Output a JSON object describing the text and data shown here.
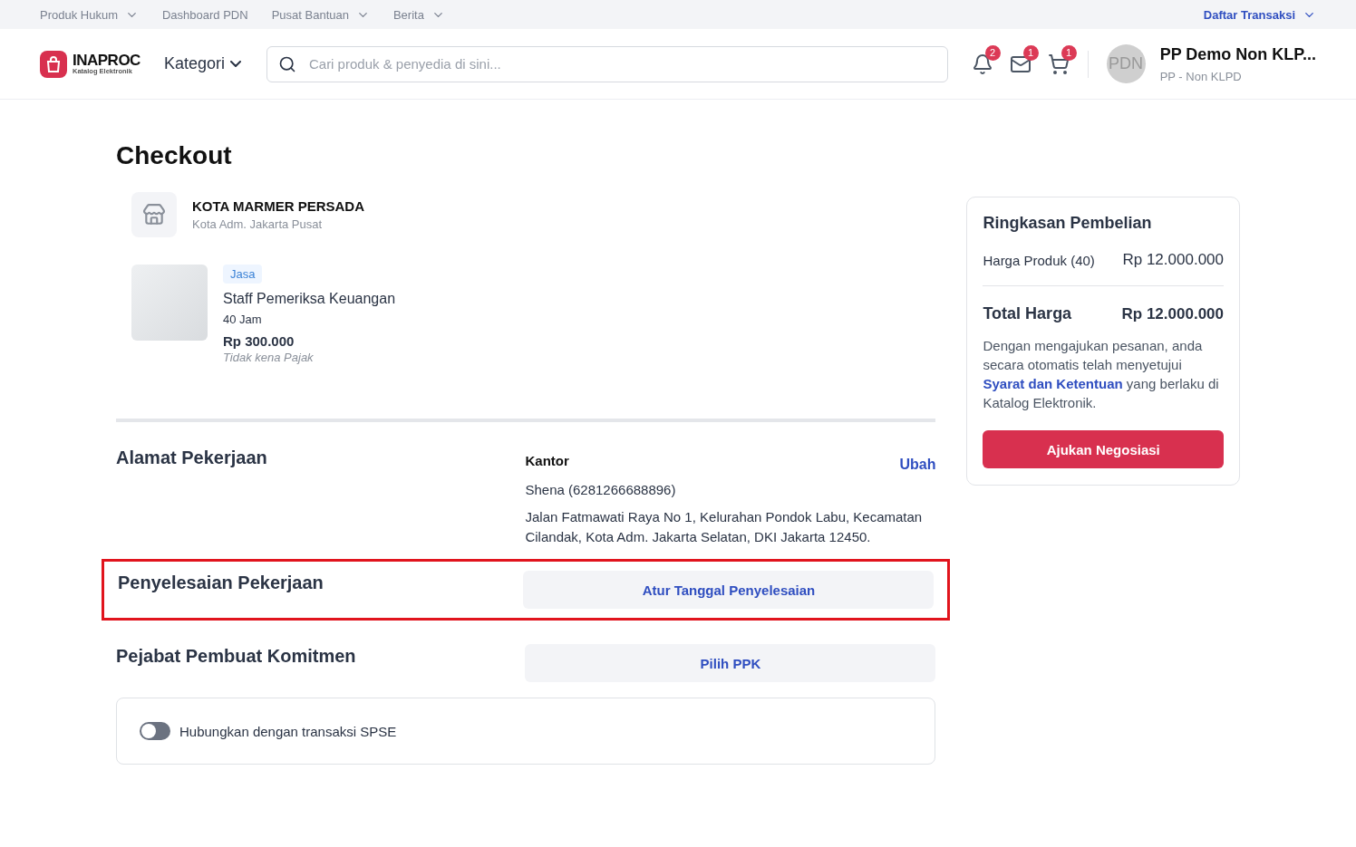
{
  "top_nav": {
    "links": [
      {
        "label": "Produk Hukum",
        "dropdown": true
      },
      {
        "label": "Dashboard PDN",
        "dropdown": false
      },
      {
        "label": "Pusat Bantuan",
        "dropdown": true
      },
      {
        "label": "Berita",
        "dropdown": true
      }
    ],
    "right_link": {
      "label": "Daftar Transaksi",
      "dropdown": true
    }
  },
  "header": {
    "logo": {
      "name": "INAPROC",
      "tagline": "Katalog Elektronik"
    },
    "category": "Kategori",
    "search": {
      "placeholder": "Cari produk & penyedia di sini..."
    },
    "icons": [
      {
        "kind": "bell",
        "badge": "2"
      },
      {
        "kind": "mail",
        "badge": "1"
      },
      {
        "kind": "cart",
        "badge": "1"
      }
    ],
    "user": {
      "avatar": "PDN",
      "name": "PP Demo Non KLP...",
      "role": "PP - Non KLPD"
    }
  },
  "page_title": "Checkout",
  "seller": {
    "name": "KOTA MARMER PERSADA",
    "location": "Kota Adm. Jakarta Pusat"
  },
  "product": {
    "tag": "Jasa",
    "name": "Staff Pemeriksa Keuangan",
    "quantity": "40 Jam",
    "price": "Rp 300.000",
    "tax_note": "Tidak kena Pajak"
  },
  "sections": [
    {
      "kind": "address",
      "title": "Alamat Pekerjaan",
      "highlighted": false,
      "label": "Kantor",
      "action": "Ubah",
      "contact": "Shena (6281266688896)",
      "address": "Jalan Fatmawati Raya No 1, Kelurahan Pondok Labu, Kecamatan Cilandak, Kota Adm. Jakarta Selatan, DKI Jakarta 12450."
    },
    {
      "kind": "button",
      "title": "Penyelesaian Pekerjaan",
      "highlighted": true,
      "button": "Atur Tanggal Penyelesaian"
    },
    {
      "kind": "button",
      "title": "Pejabat Pembuat Komitmen",
      "highlighted": false,
      "button": "Pilih PPK"
    }
  ],
  "spse_toggle": {
    "label": "Hubungkan dengan transaksi SPSE",
    "on": false
  },
  "summary": {
    "title": "Ringkasan Pembelian",
    "lines": [
      {
        "label": "Harga Produk (40)",
        "value": "Rp 12.000.000"
      }
    ],
    "total_label": "Total Harga",
    "total_value": "Rp 12.000.000",
    "agreement": "Dengan mengajukan pesanan, anda secara otomatis telah menyetujui ",
    "terms_link": "Syarat dan Ketentuan",
    "agreement_end": " yang berlaku di Katalog Elektronik.",
    "submit": "Ajukan Negosiasi"
  }
}
